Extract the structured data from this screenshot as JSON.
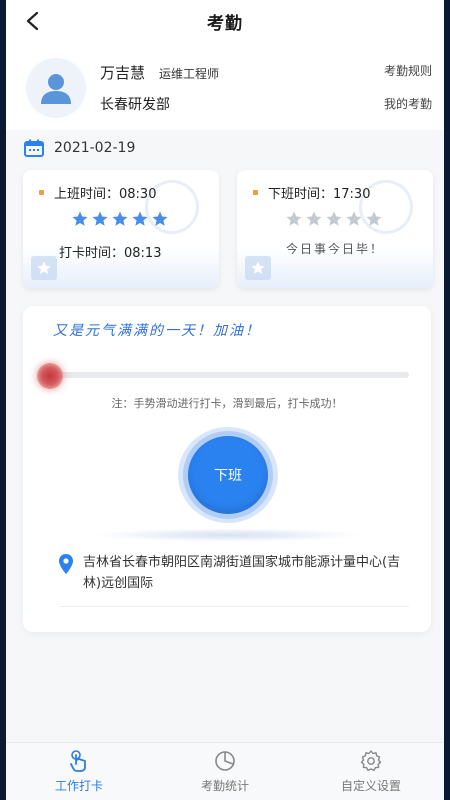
{
  "header": {
    "title": "考勤"
  },
  "profile": {
    "name": "万吉慧",
    "role": "运维工程师",
    "department": "长春研发部",
    "link_rules": "考勤规则",
    "link_mine": "我的考勤"
  },
  "date": "2021-02-19",
  "cards": {
    "on_duty": {
      "label": "上班时间：08:30",
      "rating": 5,
      "punch_label": "打卡时间：08:13"
    },
    "off_duty": {
      "label": "下班时间：17:30",
      "rating": 0,
      "message": "今日事今日毕！"
    }
  },
  "panel": {
    "slogan": "又是元气满满的一天！加油！",
    "slider_progress": 0,
    "hint": "注：手势滑动进行打卡，滑到最后，打卡成功！",
    "clock_button": "下班",
    "address": "吉林省长春市朝阳区南湖街道国家城市能源计量中心(吉林)远创国际"
  },
  "tabbar": {
    "tabs": [
      {
        "label": "工作打卡",
        "icon": "hand-tap-icon",
        "active": true
      },
      {
        "label": "考勤统计",
        "icon": "pie-chart-icon",
        "active": false
      },
      {
        "label": "自定义设置",
        "icon": "gear-icon",
        "active": false
      }
    ]
  },
  "colors": {
    "accent": "#2a82f0",
    "star_on": "#4a8de8",
    "star_off": "#c4c8cf",
    "dot": "#f0a030",
    "slider_knob": "#c4373b"
  }
}
